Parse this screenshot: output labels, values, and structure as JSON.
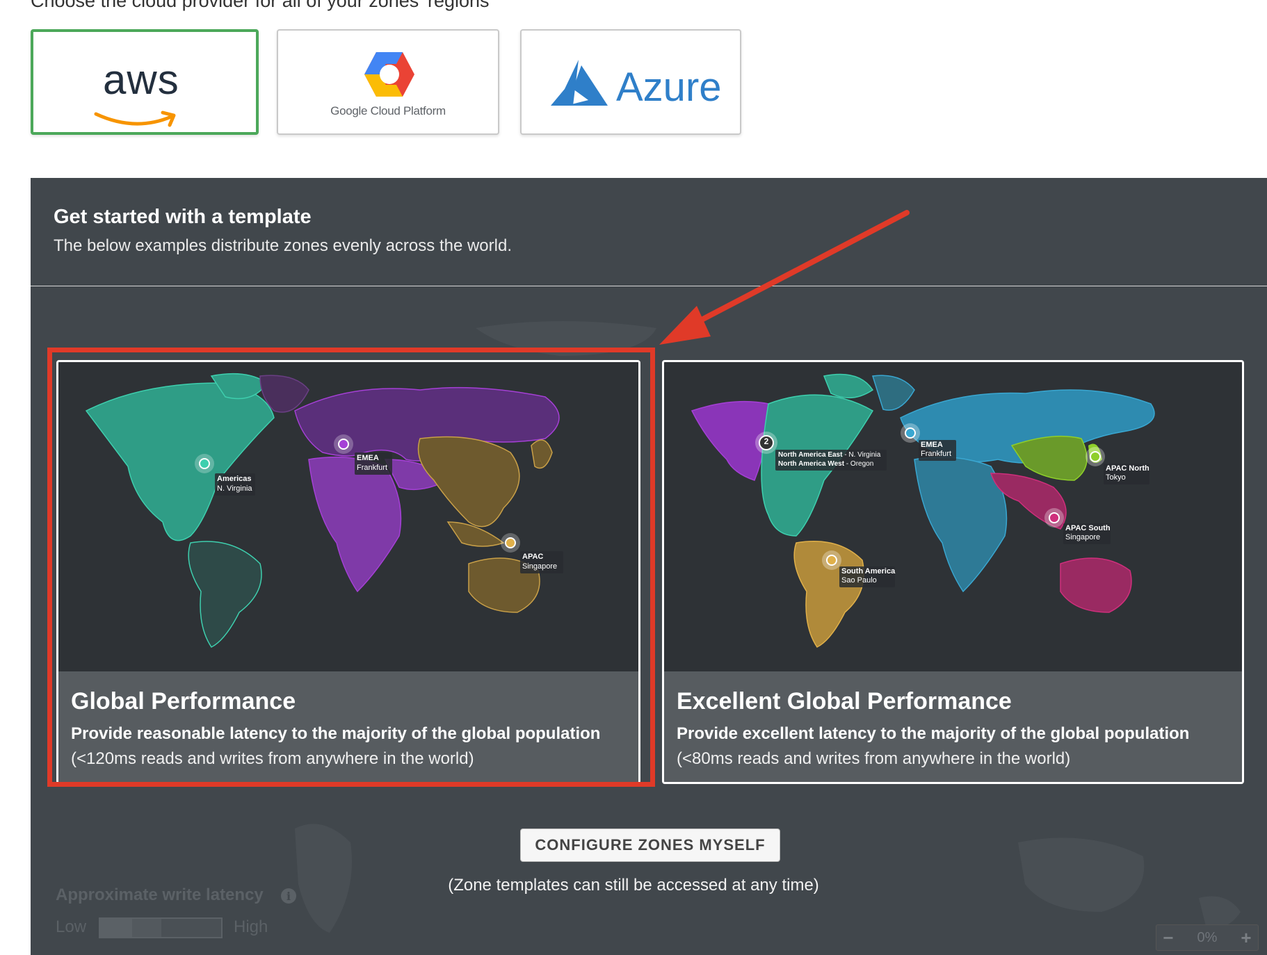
{
  "header": {
    "title": "Choose the cloud provider for all of your zones' regions"
  },
  "providers": [
    {
      "id": "aws",
      "label": "aws",
      "selected": true
    },
    {
      "id": "gcp",
      "label": "Google Cloud Platform",
      "selected": false
    },
    {
      "id": "azure",
      "label": "Azure",
      "selected": false
    }
  ],
  "template_section": {
    "title": "Get started with a template",
    "subtitle": "The below examples distribute zones evenly across the world."
  },
  "templates": [
    {
      "title": "Global Performance",
      "description": "Provide reasonable latency to the majority of the global population",
      "note": "(<120ms reads and writes from anywhere in the world)",
      "zones": [
        {
          "name": "Americas",
          "region": "N. Virginia"
        },
        {
          "name": "EMEA",
          "region": "Frankfurt"
        },
        {
          "name": "APAC",
          "region": "Singapore"
        }
      ]
    },
    {
      "title": "Excellent Global Performance",
      "description": "Provide excellent latency to the majority of the global population",
      "note": "(<80ms reads and writes from anywhere in the world)",
      "cluster_count": "2",
      "zones": [
        {
          "name": "North America East",
          "region": "N. Virginia"
        },
        {
          "name": "North America West",
          "region": "Oregon"
        },
        {
          "name": "EMEA",
          "region": "Frankfurt"
        },
        {
          "name": "APAC North",
          "region": "Tokyo"
        },
        {
          "name": "APAC South",
          "region": "Singapore"
        },
        {
          "name": "South America",
          "region": "Sao Paulo"
        }
      ]
    }
  ],
  "actions": {
    "configure_label": "CONFIGURE ZONES MYSELF",
    "configure_note": "(Zone templates can still be accessed at any time)"
  },
  "latency": {
    "label": "Approximate write latency",
    "low": "Low",
    "high": "High"
  },
  "zoom": {
    "value": "0%",
    "minus": "−",
    "plus": "+"
  },
  "colors": {
    "selected_border": "#4ca85a",
    "highlight": "#e03a28",
    "panel_bg": "#41474c",
    "americas": "#3ecfae",
    "emea": "#a540d6",
    "apac": "#c9a048",
    "excellent_na": "#a540d6",
    "excellent_emea": "#3aa7d1",
    "excellent_apac_north": "#8fcf2a",
    "excellent_apac_south": "#cf2f7c",
    "excellent_sa": "#e0b04a"
  }
}
